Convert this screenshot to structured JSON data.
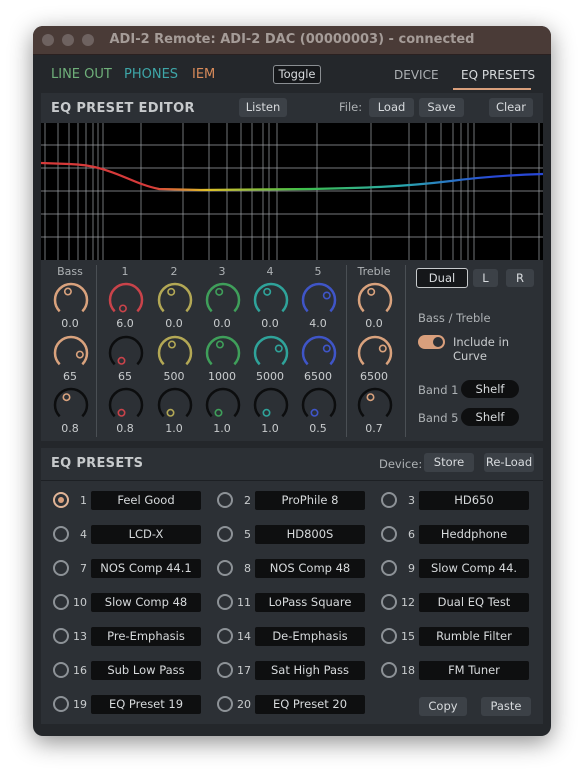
{
  "window": {
    "title": "ADI-2 Remote: ADI-2 DAC (00000003) - connected"
  },
  "tabs": {
    "line_out": "LINE OUT",
    "phones": "PHONES",
    "iem": "IEM",
    "toggle": "Toggle",
    "device": "DEVICE",
    "eq_presets": "EQ PRESETS"
  },
  "editor": {
    "title": "EQ PRESET EDITOR",
    "listen": "Listen",
    "file_label": "File:",
    "load": "Load",
    "save": "Save",
    "clear": "Clear"
  },
  "bands": {
    "headers": [
      "Bass",
      "1",
      "2",
      "3",
      "4",
      "5",
      "Treble"
    ],
    "gain": [
      "0.0",
      "6.0",
      "0.0",
      "0.0",
      "0.0",
      "4.0",
      "0.0"
    ],
    "freq": [
      "65",
      "65",
      "500",
      "1000",
      "5000",
      "6500",
      "6500"
    ],
    "q": [
      "0.8",
      "0.8",
      "1.0",
      "1.0",
      "1.0",
      "0.5",
      "0.7"
    ],
    "knob_colors": [
      "#d9a27d",
      "#c9434a",
      "#b3a855",
      "#3f9f5a",
      "#2fa39a",
      "#3f55c8",
      "#d9a27d"
    ]
  },
  "right_controls": {
    "dual": "Dual",
    "left": "L",
    "right": "R",
    "bass_treble": "Bass / Treble",
    "include_in_curve": "Include in Curve",
    "band1_label": "Band 1",
    "band1_value": "Shelf",
    "band5_label": "Band 5",
    "band5_value": "Shelf"
  },
  "presets_panel": {
    "title": "EQ PRESETS",
    "device_label": "Device:",
    "store": "Store",
    "reload": "Re-Load",
    "copy": "Copy",
    "paste": "Paste",
    "items": [
      {
        "num": "1",
        "name": "Feel Good"
      },
      {
        "num": "2",
        "name": "ProPhile 8"
      },
      {
        "num": "3",
        "name": "HD650"
      },
      {
        "num": "4",
        "name": "LCD-X"
      },
      {
        "num": "5",
        "name": "HD800S"
      },
      {
        "num": "6",
        "name": "Heddphone"
      },
      {
        "num": "7",
        "name": "NOS Comp 44.1"
      },
      {
        "num": "8",
        "name": "NOS Comp 48"
      },
      {
        "num": "9",
        "name": "Slow Comp 44."
      },
      {
        "num": "10",
        "name": "Slow Comp 48"
      },
      {
        "num": "11",
        "name": "LoPass Square"
      },
      {
        "num": "12",
        "name": "Dual EQ Test"
      },
      {
        "num": "13",
        "name": "Pre-Emphasis"
      },
      {
        "num": "14",
        "name": "De-Emphasis"
      },
      {
        "num": "15",
        "name": "Rumble Filter"
      },
      {
        "num": "16",
        "name": "Sub Low Pass"
      },
      {
        "num": "17",
        "name": "Sat High Pass"
      },
      {
        "num": "18",
        "name": "FM Tuner"
      },
      {
        "num": "19",
        "name": "EQ Preset 19"
      },
      {
        "num": "20",
        "name": "EQ Preset 20"
      }
    ],
    "selected": "1"
  },
  "colors": {
    "accent": "#d99f7c",
    "line_out": "#6fb07a",
    "phones": "#3ea6a8",
    "iem": "#d98b5a"
  }
}
